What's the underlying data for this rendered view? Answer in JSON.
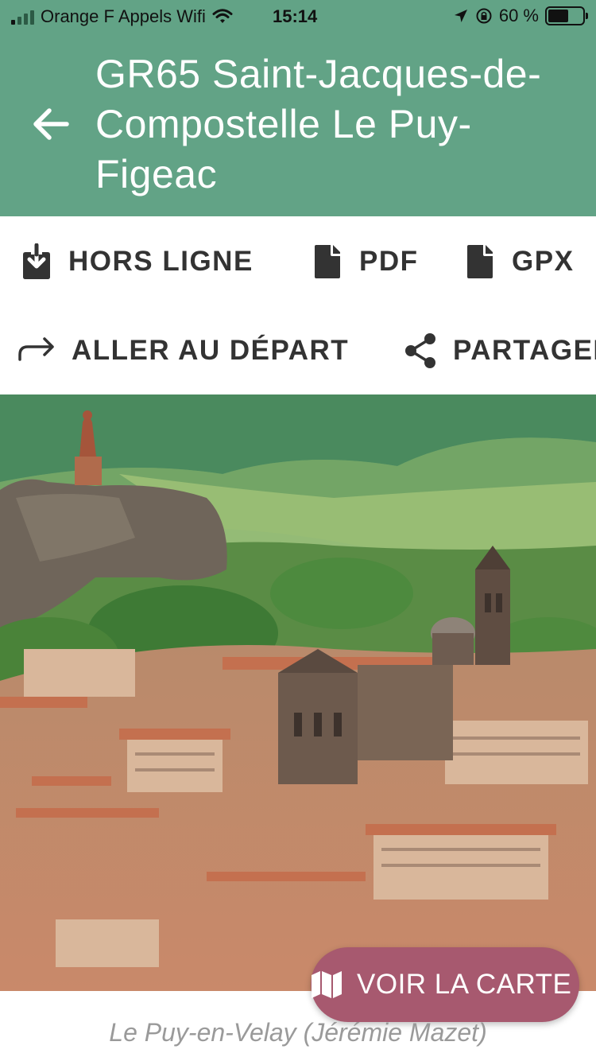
{
  "status_bar": {
    "carrier": "Orange F Appels Wifi",
    "time": "15:14",
    "battery": "60 %",
    "battery_level": 0.6
  },
  "header": {
    "title": "GR65 Saint-Jacques-de-Compostelle Le Puy-Figeac",
    "back_icon": "arrow-left-icon"
  },
  "actions": {
    "offline": {
      "label": "HORS LIGNE",
      "icon": "download-icon"
    },
    "pdf": {
      "label": "PDF",
      "icon": "file-icon"
    },
    "gpx": {
      "label": "GPX",
      "icon": "file-icon"
    },
    "go_to_start": {
      "label": "ALLER AU DÉPART",
      "icon": "route-arrow-icon"
    },
    "share": {
      "label": "PARTAGER",
      "icon": "share-icon"
    }
  },
  "photo": {
    "caption": "Le Puy-en-Velay (Jérémie Mazet)"
  },
  "map_button": {
    "label": "VOIR LA CARTE",
    "icon": "map-icon"
  },
  "colors": {
    "header_bg": "#62a386",
    "map_button_bg": "#a7596f",
    "action_text": "#333333",
    "caption_text": "#9a9a9a"
  }
}
